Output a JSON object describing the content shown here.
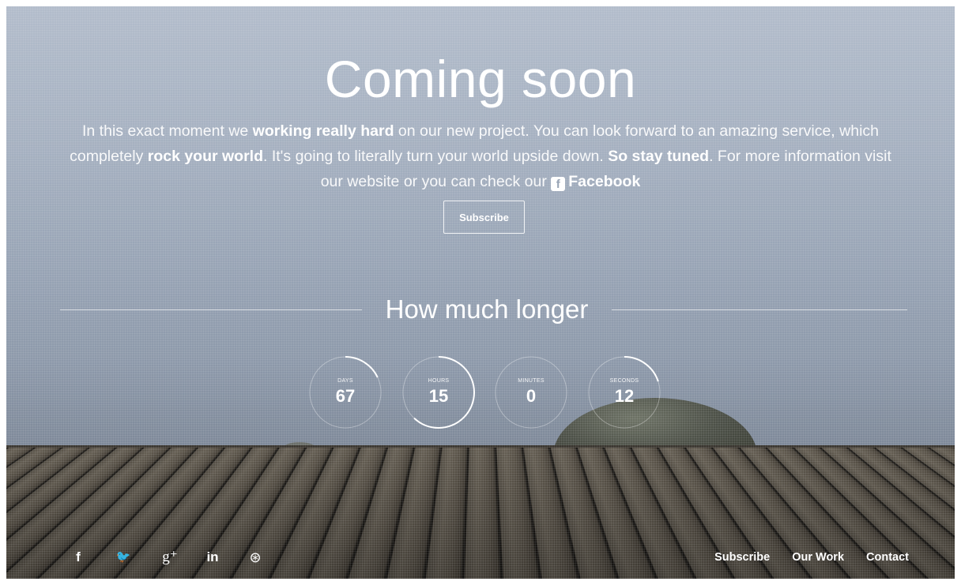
{
  "hero": {
    "title": "Coming soon",
    "intro": {
      "t1": "In this exact moment we ",
      "b1": "working really hard",
      "t2": " on our new project. You can look forward to an amazing service, which completely ",
      "b2": "rock your world",
      "t3": ". It's going to literally turn your world upside down. ",
      "b3": "So stay tuned",
      "t4": ". For more information visit our website or you can check our ",
      "facebook_icon_glyph": "f",
      "facebook_link": "Facebook"
    },
    "subscribe_label": "Subscribe"
  },
  "countdown": {
    "heading": "How much longer",
    "units": [
      {
        "label": "DAYS",
        "value": "67",
        "progress": 0.18
      },
      {
        "label": "HOURS",
        "value": "15",
        "progress": 0.62
      },
      {
        "label": "MINUTES",
        "value": "0",
        "progress": 0.0
      },
      {
        "label": "SECONDS",
        "value": "12",
        "progress": 0.2
      }
    ]
  },
  "footer": {
    "social": [
      {
        "icon": "facebook-icon",
        "glyph": "f"
      },
      {
        "icon": "twitter-icon",
        "glyph": "🐦"
      },
      {
        "icon": "google-plus-icon",
        "glyph": "g⁺"
      },
      {
        "icon": "linkedin-icon",
        "glyph": "in"
      },
      {
        "icon": "dribbble-icon",
        "glyph": "⊛"
      }
    ],
    "nav": [
      "Subscribe",
      "Our Work",
      "Contact"
    ]
  },
  "colors": {
    "sky": "#a5b0c0",
    "text": "#ffffff"
  }
}
